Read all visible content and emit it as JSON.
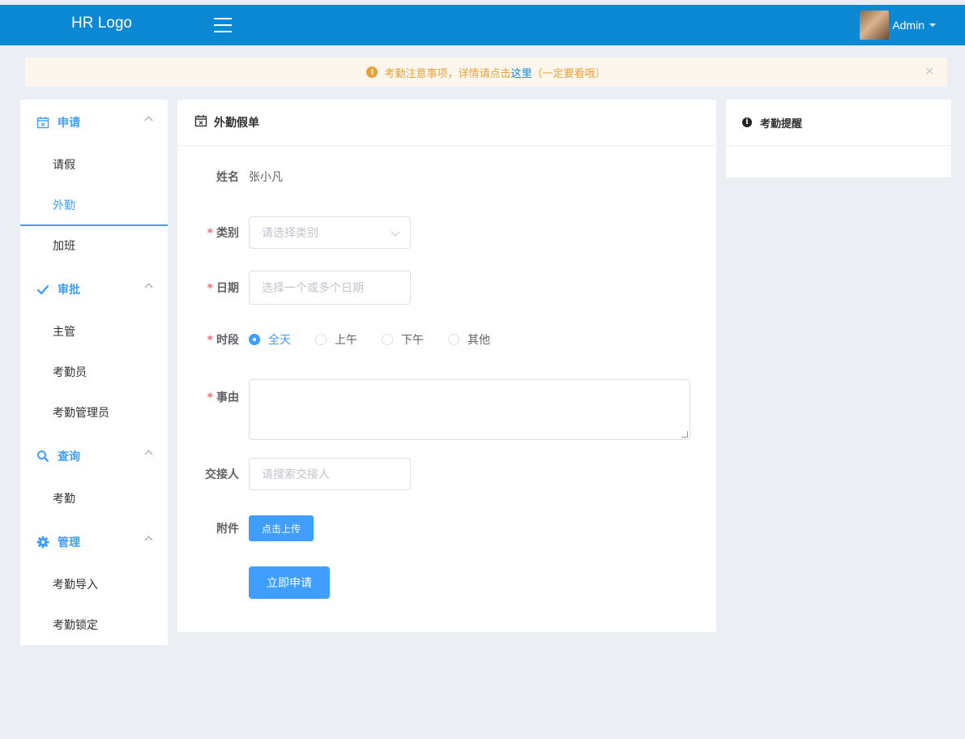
{
  "header": {
    "logo": "HR Logo",
    "user_name": "Admin"
  },
  "notice": {
    "text": "考勤注意事项，详情请点击",
    "link": "这里",
    "suffix": "（一定要看哦）",
    "close": "×",
    "icon": "!"
  },
  "sidebar": {
    "groups": [
      {
        "title": "申请",
        "icon": "calendar-icon",
        "items": [
          "请假",
          "外勤",
          "加班"
        ]
      },
      {
        "title": "审批",
        "icon": "check-icon",
        "items": [
          "主管",
          "考勤员",
          "考勤管理员"
        ]
      },
      {
        "title": "查询",
        "icon": "search-icon",
        "items": [
          "考勤"
        ]
      },
      {
        "title": "管理",
        "icon": "gear-icon",
        "items": [
          "考勤导入",
          "考勤锁定"
        ]
      }
    ],
    "active_item": "外勤"
  },
  "form": {
    "title": "外勤假单",
    "name_label": "姓名",
    "name_value": "张小凡",
    "required_mark": "*",
    "category_label": "类别",
    "category_placeholder": "请选择类别",
    "date_label": "日期",
    "date_placeholder": "选择一个或多个日期",
    "period_label": "时段",
    "period_options": [
      "全天",
      "上午",
      "下午",
      "其他"
    ],
    "period_selected": "全天",
    "reason_label": "事由",
    "handover_label": "交接人",
    "handover_placeholder": "请搜索交接人",
    "attachment_label": "附件",
    "upload_button": "点击上传",
    "submit_button": "立即申请"
  },
  "reminder": {
    "title": "考勤提醒",
    "icon": "i"
  },
  "colors": {
    "topbar": "#0a88d3",
    "accent": "#409eff",
    "warning": "#e6a23c",
    "required": "#f56c6c"
  }
}
